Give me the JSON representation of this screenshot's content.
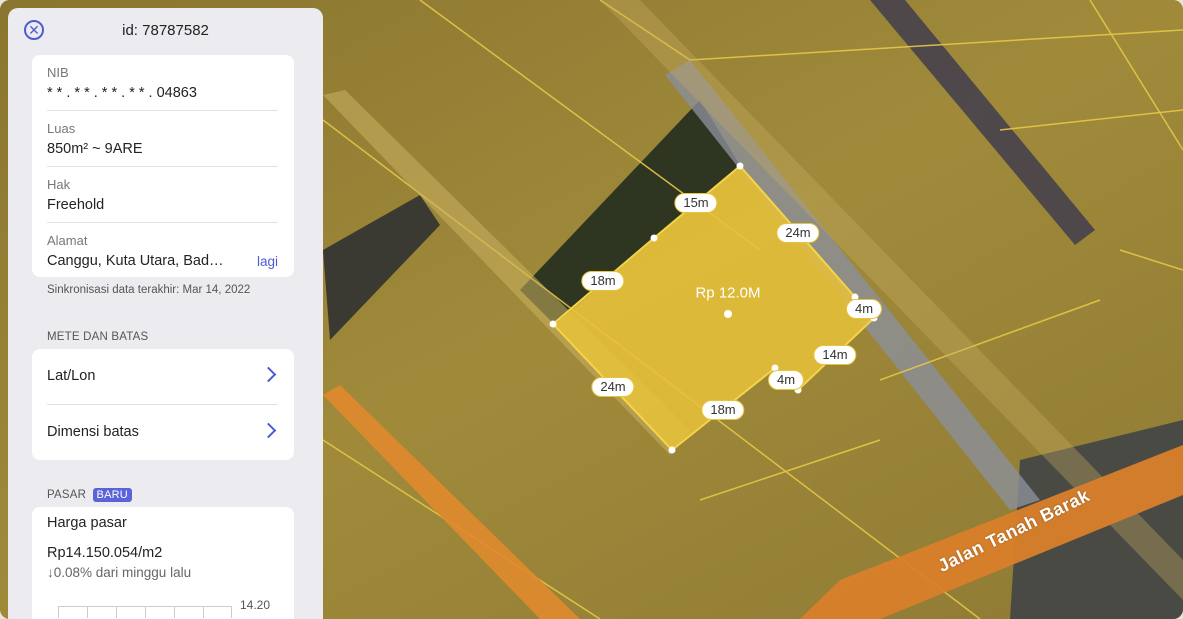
{
  "panel": {
    "title": "id: 78787582",
    "close_icon": "close-icon"
  },
  "parcel": {
    "nib_label": "NIB",
    "nib_value": "* * . * * . * * . * * . 04863",
    "area_label": "Luas",
    "area_value": "850m² ~ 9ARE",
    "rights_label": "Hak",
    "rights_value": "Freehold",
    "address_label": "Alamat",
    "address_value": "Canggu, Kuta Utara, Badung",
    "more_link": "lagi",
    "sync_text": "Sinkronisasi data terakhir: Mar 14, 2022"
  },
  "bounds": {
    "section_label": "METE DAN BATAS",
    "latlon_label": "Lat/Lon",
    "dimensions_label": "Dimensi batas"
  },
  "market": {
    "section_label": "PASAR",
    "badge": "BARU",
    "title": "Harga pasar",
    "price": "Rp14.150.054/m2",
    "change": "↓0.08%  dari minggu lalu",
    "axis_value": "14.20"
  },
  "map": {
    "parcel_price": "Rp 12.0M",
    "street_name": "Jalan Tanah Barak",
    "dimension_labels": [
      "15m",
      "24m",
      "18m",
      "4m",
      "14m",
      "4m",
      "18m",
      "24m"
    ],
    "colors": {
      "parcel_fill": "#e8c23a",
      "parcel_border": "#f5d34a",
      "road": "#e08a2e",
      "accent": "#4d5bd4"
    }
  }
}
